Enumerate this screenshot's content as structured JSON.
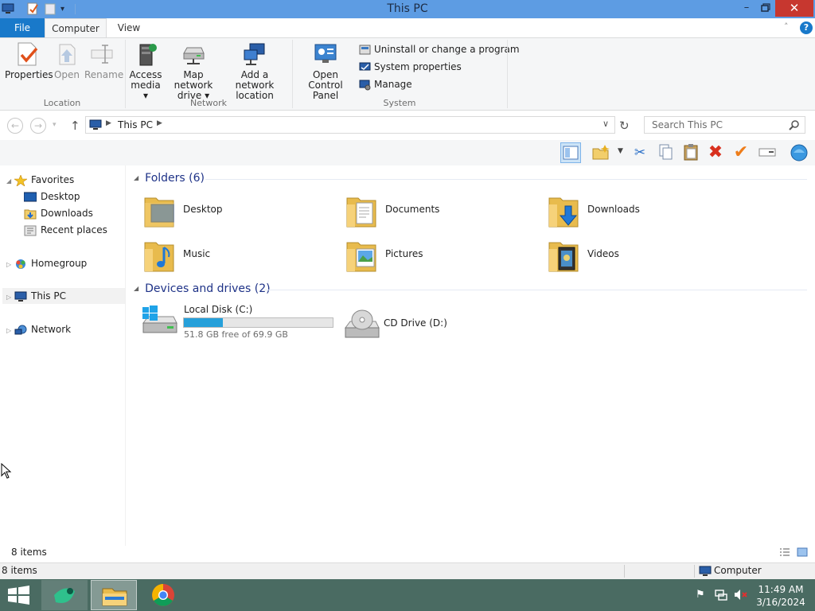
{
  "window": {
    "title": "This PC"
  },
  "ribbon_tabs": {
    "file": "File",
    "computer": "Computer",
    "view": "View"
  },
  "ribbon": {
    "location": {
      "label": "Location",
      "properties": "Properties",
      "open": "Open",
      "rename": "Rename"
    },
    "network": {
      "label": "Network",
      "access_media_1": "Access",
      "access_media_2": "media",
      "map_drive_1": "Map network",
      "map_drive_2": "drive",
      "add_location_1": "Add a network",
      "add_location_2": "location"
    },
    "system": {
      "label": "System",
      "control_panel_1": "Open Control",
      "control_panel_2": "Panel",
      "uninstall": "Uninstall or change a program",
      "sys_props": "System properties",
      "manage": "Manage"
    }
  },
  "address": {
    "path": "This PC",
    "search_placeholder": "Search This PC"
  },
  "navpane": {
    "favorites": "Favorites",
    "desktop": "Desktop",
    "downloads": "Downloads",
    "recent": "Recent places",
    "homegroup": "Homegroup",
    "this_pc": "This PC",
    "network": "Network"
  },
  "content": {
    "folders_head": "Folders (6)",
    "folders": [
      {
        "name": "Desktop"
      },
      {
        "name": "Documents"
      },
      {
        "name": "Downloads"
      },
      {
        "name": "Music"
      },
      {
        "name": "Pictures"
      },
      {
        "name": "Videos"
      }
    ],
    "drives_head": "Devices and drives (2)",
    "drives": [
      {
        "name": "Local Disk (C:)",
        "free_text": "51.8 GB free of 69.9 GB",
        "used_fraction": 0.26
      },
      {
        "name": "CD Drive (D:)"
      }
    ]
  },
  "status": {
    "items": "8 items",
    "items2": "8 items",
    "computer": "Computer"
  },
  "taskbar": {
    "time": "11:49 AM",
    "date": "3/16/2024"
  },
  "colors": {
    "accent": "#1979ca",
    "titlebar": "#5d9ce3",
    "close": "#c7372f",
    "taskbar": "#4a6b62"
  }
}
